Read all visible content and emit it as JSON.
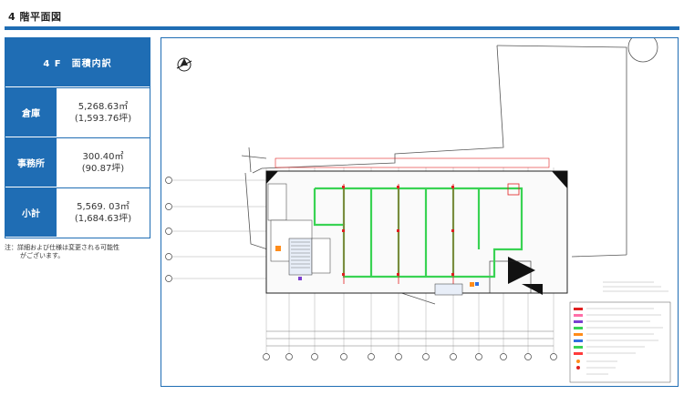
{
  "page": {
    "title": "4 階平面図"
  },
  "area_table": {
    "header": "4 F　面積内訳",
    "rows": [
      {
        "label": "倉庫",
        "value1": "5,268.63㎡",
        "value2": "(1,593.76坪)"
      },
      {
        "label": "事務所",
        "value1": "300.40㎡",
        "value2": "(90.87坪)"
      },
      {
        "label": "小計",
        "value1": "5,569. 03㎡",
        "value2": "(1,684.63坪)"
      }
    ]
  },
  "note": {
    "line1": "注：詳細および仕様は変更される可能性",
    "line2": "がございます。"
  },
  "colors": {
    "accent": "#1f6db4",
    "plan_green": "#39d353",
    "plan_red": "#e02020"
  }
}
